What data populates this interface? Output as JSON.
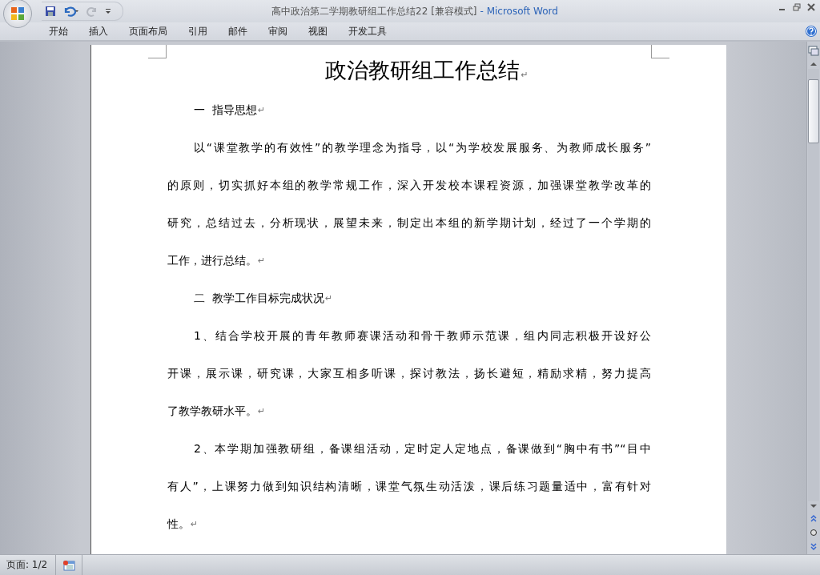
{
  "window": {
    "title": "高中政治第二学期教研组工作总结22 [兼容模式]",
    "app_name": "- Microsoft Word"
  },
  "ribbon_tabs": [
    {
      "label": "开始"
    },
    {
      "label": "插入"
    },
    {
      "label": "页面布局"
    },
    {
      "label": "引用"
    },
    {
      "label": "邮件"
    },
    {
      "label": "审阅"
    },
    {
      "label": "视图"
    },
    {
      "label": "开发工具"
    }
  ],
  "document": {
    "title": "政治教研组工作总结",
    "paragraph_mark": "↵",
    "paragraphs": [
      {
        "kind": "heading",
        "lines": [
          "一  指导思想"
        ]
      },
      {
        "kind": "body",
        "lines": [
          "以“课堂教学的有效性”的教学理念为指导，以“为学校发展服务、为教师成长服务”",
          "的原则，切实抓好本组的教学常规工作，深入开发校本课程资源，加强课堂教学改革的",
          "研究，总结过去，分析现状，展望未来，制定出本组的新学期计划，经过了一个学期的",
          "工作，进行总结。"
        ]
      },
      {
        "kind": "heading",
        "lines": [
          "二  教学工作目标完成状况"
        ]
      },
      {
        "kind": "body",
        "lines": [
          "1、结合学校开展的青年教师赛课活动和骨干教师示范课，组内同志积极开设好公",
          "开课，展示课，研究课，大家互相多听课，探讨教法，扬长避短，精励求精，努力提高",
          "了教学教研水平。"
        ]
      },
      {
        "kind": "body",
        "lines": [
          "2、本学期加强教研组，备课组活动，定时定人定地点，备课做到“胸中有书”“目中",
          "有人”，上课努力做到知识结构清晰，课堂气氛生动活泼，课后练习题量适中，富有针对",
          "性。"
        ]
      }
    ]
  },
  "status_bar": {
    "page": "页面: 1/2"
  }
}
